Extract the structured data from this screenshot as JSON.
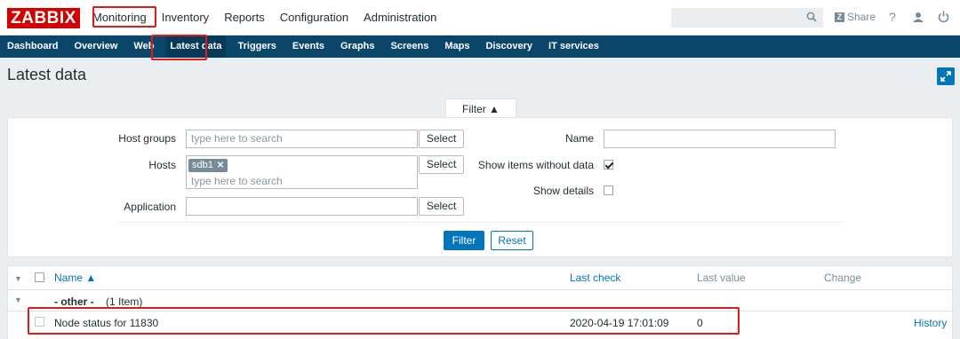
{
  "app": {
    "logo": "ZABBIX"
  },
  "main_menu": [
    "Monitoring",
    "Inventory",
    "Reports",
    "Configuration",
    "Administration"
  ],
  "search": {
    "placeholder": "",
    "value": ""
  },
  "header_actions": {
    "share": "Share",
    "help": "?"
  },
  "sub_menu": [
    "Dashboard",
    "Overview",
    "Web",
    "Latest data",
    "Triggers",
    "Events",
    "Graphs",
    "Screens",
    "Maps",
    "Discovery",
    "IT services"
  ],
  "page": {
    "title": "Latest data"
  },
  "filter": {
    "tab_label": "Filter ▲",
    "host_groups_label": "Host groups",
    "host_groups_placeholder": "type here to search",
    "hosts_label": "Hosts",
    "hosts_selected": "sdb1",
    "hosts_placeholder": "type here to search",
    "application_label": "Application",
    "application_value": "",
    "select_label": "Select",
    "name_label": "Name",
    "name_value": "",
    "show_items_without_data_label": "Show items without data",
    "show_items_without_data_checked": true,
    "show_details_label": "Show details",
    "show_details_checked": false,
    "filter_button": "Filter",
    "reset_button": "Reset"
  },
  "table": {
    "columns": {
      "name": "Name ▲",
      "last_check": "Last check",
      "last_value": "Last value",
      "change": "Change"
    },
    "group": {
      "name": "- other -",
      "count": "(1 Item)"
    },
    "rows": [
      {
        "name": "Node status for 11830",
        "last_check": "2020-04-19 17:01:09",
        "last_value": "0",
        "change": "",
        "action": "History"
      }
    ]
  },
  "colors": {
    "brand_red": "#d40000",
    "nav_blue": "#0a466a",
    "accent_blue": "#0275b8",
    "highlight_red": "#e01b1b"
  }
}
